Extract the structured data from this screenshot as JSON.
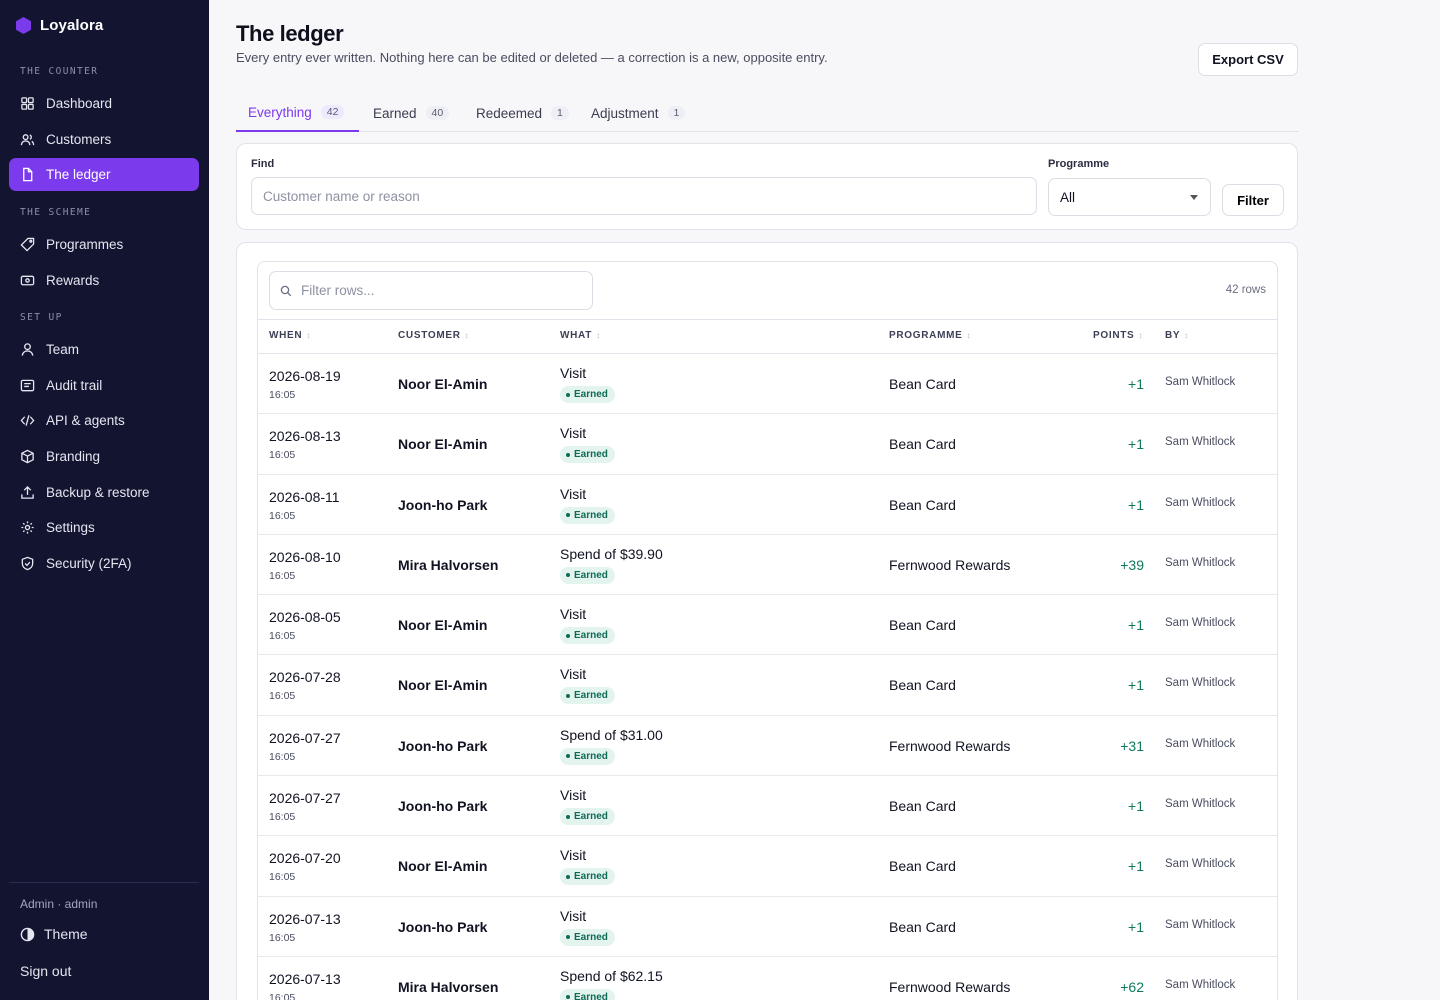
{
  "brand": {
    "name": "Loyalora",
    "color": "#7c3aed"
  },
  "sidebar": {
    "sections": [
      {
        "label": "The counter",
        "items": [
          {
            "label": "Dashboard",
            "icon": "grid-icon"
          },
          {
            "label": "Customers",
            "icon": "users-icon"
          },
          {
            "label": "The ledger",
            "icon": "file-icon",
            "active": true
          }
        ]
      },
      {
        "label": "The scheme",
        "items": [
          {
            "label": "Programmes",
            "icon": "tag-icon"
          },
          {
            "label": "Rewards",
            "icon": "ticket-icon"
          }
        ]
      },
      {
        "label": "Set up",
        "items": [
          {
            "label": "Team",
            "icon": "user-icon"
          },
          {
            "label": "Audit trail",
            "icon": "list-icon"
          },
          {
            "label": "API & agents",
            "icon": "code-icon"
          },
          {
            "label": "Branding",
            "icon": "box-icon"
          },
          {
            "label": "Backup & restore",
            "icon": "upload-icon"
          },
          {
            "label": "Settings",
            "icon": "gear-icon"
          },
          {
            "label": "Security (2FA)",
            "icon": "shield-icon"
          }
        ]
      }
    ],
    "user": "Admin · admin",
    "theme_label": "Theme",
    "signout_label": "Sign out"
  },
  "header": {
    "title": "The ledger",
    "subtitle": "Every entry ever written. Nothing here can be edited or deleted — a correction is a new, opposite entry.",
    "export_label": "Export CSV"
  },
  "tabs": [
    {
      "label": "Everything",
      "count": "42",
      "active": true
    },
    {
      "label": "Earned",
      "count": "40"
    },
    {
      "label": "Redeemed",
      "count": "1"
    },
    {
      "label": "Adjustment",
      "count": "1"
    }
  ],
  "filters": {
    "find_label": "Find",
    "find_placeholder": "Customer name or reason",
    "programme_label": "Programme",
    "programme_value": "All",
    "filter_label": "Filter"
  },
  "table": {
    "row_filter_placeholder": "Filter rows...",
    "row_count": "42 rows",
    "columns": [
      "WHEN",
      "CUSTOMER",
      "WHAT",
      "PROGRAMME",
      "POINTS",
      "BY"
    ],
    "rows": [
      {
        "date": "2026-08-19",
        "time": "16:05",
        "customer": "Noor El-Amin",
        "what": "Visit",
        "type": "Earned",
        "programme": "Bean Card",
        "points": "+1",
        "by": "Sam Whitlock"
      },
      {
        "date": "2026-08-13",
        "time": "16:05",
        "customer": "Noor El-Amin",
        "what": "Visit",
        "type": "Earned",
        "programme": "Bean Card",
        "points": "+1",
        "by": "Sam Whitlock"
      },
      {
        "date": "2026-08-11",
        "time": "16:05",
        "customer": "Joon-ho Park",
        "what": "Visit",
        "type": "Earned",
        "programme": "Bean Card",
        "points": "+1",
        "by": "Sam Whitlock"
      },
      {
        "date": "2026-08-10",
        "time": "16:05",
        "customer": "Mira Halvorsen",
        "what": "Spend of $39.90",
        "type": "Earned",
        "programme": "Fernwood Rewards",
        "points": "+39",
        "by": "Sam Whitlock"
      },
      {
        "date": "2026-08-05",
        "time": "16:05",
        "customer": "Noor El-Amin",
        "what": "Visit",
        "type": "Earned",
        "programme": "Bean Card",
        "points": "+1",
        "by": "Sam Whitlock"
      },
      {
        "date": "2026-07-28",
        "time": "16:05",
        "customer": "Noor El-Amin",
        "what": "Visit",
        "type": "Earned",
        "programme": "Bean Card",
        "points": "+1",
        "by": "Sam Whitlock"
      },
      {
        "date": "2026-07-27",
        "time": "16:05",
        "customer": "Joon-ho Park",
        "what": "Spend of $31.00",
        "type": "Earned",
        "programme": "Fernwood Rewards",
        "points": "+31",
        "by": "Sam Whitlock"
      },
      {
        "date": "2026-07-27",
        "time": "16:05",
        "customer": "Joon-ho Park",
        "what": "Visit",
        "type": "Earned",
        "programme": "Bean Card",
        "points": "+1",
        "by": "Sam Whitlock"
      },
      {
        "date": "2026-07-20",
        "time": "16:05",
        "customer": "Noor El-Amin",
        "what": "Visit",
        "type": "Earned",
        "programme": "Bean Card",
        "points": "+1",
        "by": "Sam Whitlock"
      },
      {
        "date": "2026-07-13",
        "time": "16:05",
        "customer": "Joon-ho Park",
        "what": "Visit",
        "type": "Earned",
        "programme": "Bean Card",
        "points": "+1",
        "by": "Sam Whitlock"
      },
      {
        "date": "2026-07-13",
        "time": "16:05",
        "customer": "Mira Halvorsen",
        "what": "Spend of $62.15",
        "type": "Earned",
        "programme": "Fernwood Rewards",
        "points": "+62",
        "by": "Sam Whitlock"
      }
    ]
  }
}
